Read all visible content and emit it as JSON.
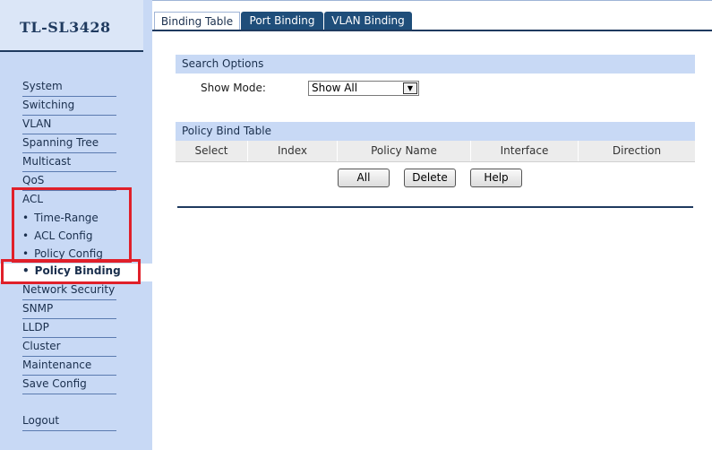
{
  "app": {
    "title": "TL-SL3428"
  },
  "sidebar": {
    "items": [
      {
        "label": "System"
      },
      {
        "label": "Switching"
      },
      {
        "label": "VLAN"
      },
      {
        "label": "Spanning Tree"
      },
      {
        "label": "Multicast"
      },
      {
        "label": "QoS"
      },
      {
        "label": "ACL"
      },
      {
        "label": "Time-Range",
        "sub": true
      },
      {
        "label": "ACL Config",
        "sub": true
      },
      {
        "label": "Policy Config",
        "sub": true
      },
      {
        "label": "Policy Binding",
        "sub": true,
        "active": true
      },
      {
        "label": "Network Security"
      },
      {
        "label": "SNMP"
      },
      {
        "label": "LLDP"
      },
      {
        "label": "Cluster"
      },
      {
        "label": "Maintenance"
      },
      {
        "label": "Save Config"
      }
    ],
    "logout": "Logout",
    "bullet": "•"
  },
  "tabs": [
    {
      "label": "Binding Table",
      "active": true
    },
    {
      "label": "Port Binding",
      "active": false
    },
    {
      "label": "VLAN Binding",
      "active": false
    }
  ],
  "search_options": {
    "header": "Search Options",
    "show_mode_label": "Show Mode:",
    "show_mode_value": "Show All"
  },
  "policy_bind_table": {
    "header": "Policy Bind Table",
    "columns": [
      "Select",
      "Index",
      "Policy Name",
      "Interface",
      "Direction"
    ]
  },
  "buttons": {
    "all": "All",
    "delete": "Delete",
    "help": "Help"
  },
  "colors": {
    "sidebar_bg": "#c8d9f5",
    "accent": "#1f4e7a",
    "highlight": "#e0202a"
  }
}
